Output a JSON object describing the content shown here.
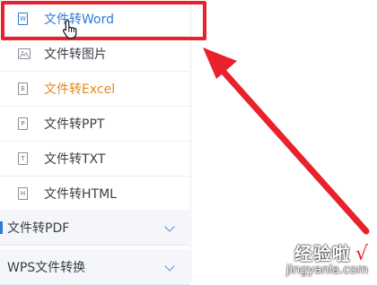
{
  "menu": {
    "items": [
      {
        "label": "文件转Word",
        "icon": "word-file-icon",
        "glyph": "W"
      },
      {
        "label": "文件转图片",
        "icon": "image-file-icon",
        "glyph": ""
      },
      {
        "label": "文件转Excel",
        "icon": "excel-file-icon",
        "glyph": "E"
      },
      {
        "label": "文件转PPT",
        "icon": "ppt-file-icon",
        "glyph": "P"
      },
      {
        "label": "文件转TXT",
        "icon": "txt-file-icon",
        "glyph": "T"
      },
      {
        "label": "文件转HTML",
        "icon": "html-file-icon",
        "glyph": "H"
      }
    ],
    "groups": [
      {
        "label": "文件转PDF",
        "icon": "chevron-down-icon"
      },
      {
        "label": "WPS文件转换",
        "icon": "chevron-down-icon"
      }
    ]
  },
  "watermark": {
    "text": "经验啦",
    "check": "√",
    "url": "jingyanla.com"
  },
  "colors": {
    "highlight": "#e8212d",
    "active_text": "#2f7bd6",
    "excel_text": "#e08a1e"
  }
}
